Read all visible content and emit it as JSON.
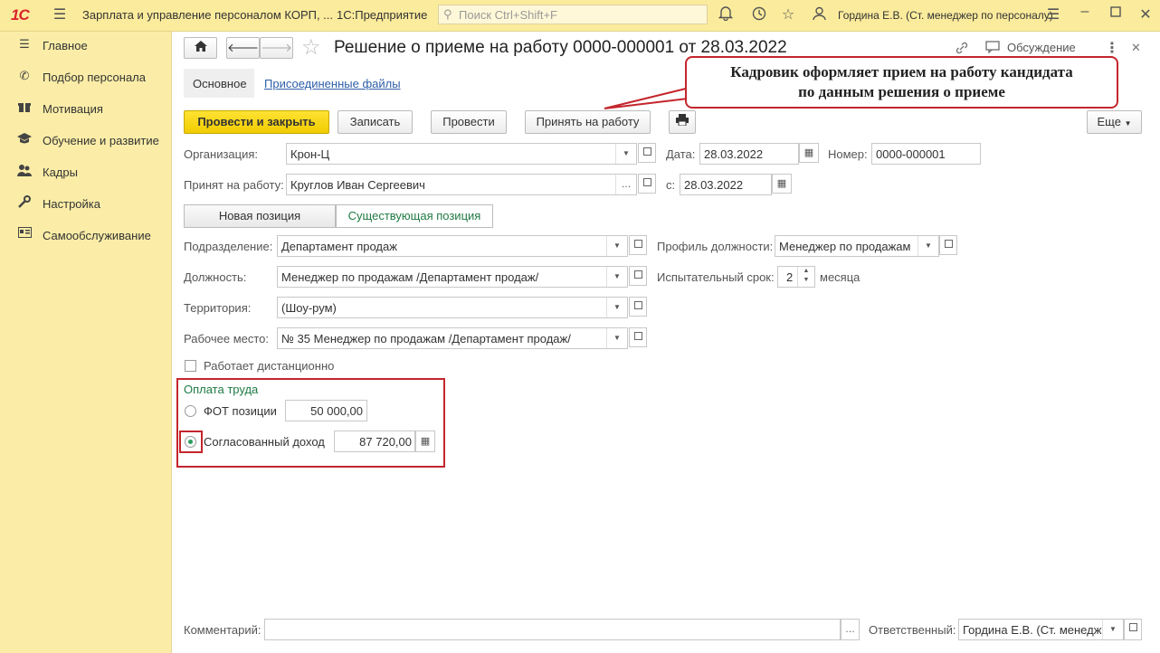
{
  "titlebar": {
    "logo": "1С",
    "app_title": "Зарплата и управление персоналом КОРП, ...",
    "platform": "1С:Предприятие",
    "search_placeholder": "Поиск Ctrl+Shift+F",
    "user": "Гордина Е.В. (Ст. менеджер по персоналу)"
  },
  "sidebar": {
    "items": [
      {
        "label": "Главное",
        "icon": "menu-icon"
      },
      {
        "label": "Подбор персонала",
        "icon": "phone-icon"
      },
      {
        "label": "Мотивация",
        "icon": "gift-icon"
      },
      {
        "label": "Обучение и развитие",
        "icon": "graduation-icon"
      },
      {
        "label": "Кадры",
        "icon": "people-icon"
      },
      {
        "label": "Настройка",
        "icon": "wrench-icon"
      },
      {
        "label": "Самообслуживание",
        "icon": "card-icon"
      }
    ]
  },
  "document": {
    "title": "Решение о приеме на работу 0000-000001 от 28.03.2022",
    "discussion": "Обсуждение",
    "tabs": [
      "Основное",
      "Присоединенные файлы"
    ]
  },
  "callout": {
    "line1": "Кадровик оформляет прием на работу кандидата",
    "line2": "по данным решения о приеме"
  },
  "toolbar": {
    "post_close": "Провести и закрыть",
    "save": "Записать",
    "post": "Провести",
    "hire": "Принять на работу",
    "more": "Еще"
  },
  "form": {
    "org_label": "Организация:",
    "org_value": "Крон-Ц",
    "date_label": "Дата:",
    "date_value": "28.03.2022",
    "number_label": "Номер:",
    "number_value": "0000-000001",
    "hired_label": "Принят на работу:",
    "hired_value": "Круглов Иван Сергеевич",
    "from_label": "с:",
    "from_value": "28.03.2022",
    "position_tabs": [
      "Новая позиция",
      "Существующая позиция"
    ],
    "dept_label": "Подразделение:",
    "dept_value": "Департамент продаж",
    "profile_label": "Профиль должности:",
    "profile_value": "Менеджер  по продажам",
    "job_label": "Должность:",
    "job_value": "Менеджер по продажам /Департамент продаж/",
    "probation_label": "Испытательный срок:",
    "probation_value": "2",
    "probation_unit": "месяца",
    "territory_label": "Территория:",
    "territory_value": "(Шоу-рум)",
    "workplace_label": "Рабочее место:",
    "workplace_value": "№ 35 Менеджер по продажам /Департамент продаж/",
    "remote_label": "Работает дистанционно",
    "pay_section": "Оплата труда",
    "fot_label": "ФОТ позиции",
    "fot_value": "50 000,00",
    "agreed_label": "Согласованный доход",
    "agreed_value": "87 720,00",
    "comment_label": "Комментарий:",
    "responsible_label": "Ответственный:",
    "responsible_value": "Гордина Е.В. (Ст. менедж"
  }
}
